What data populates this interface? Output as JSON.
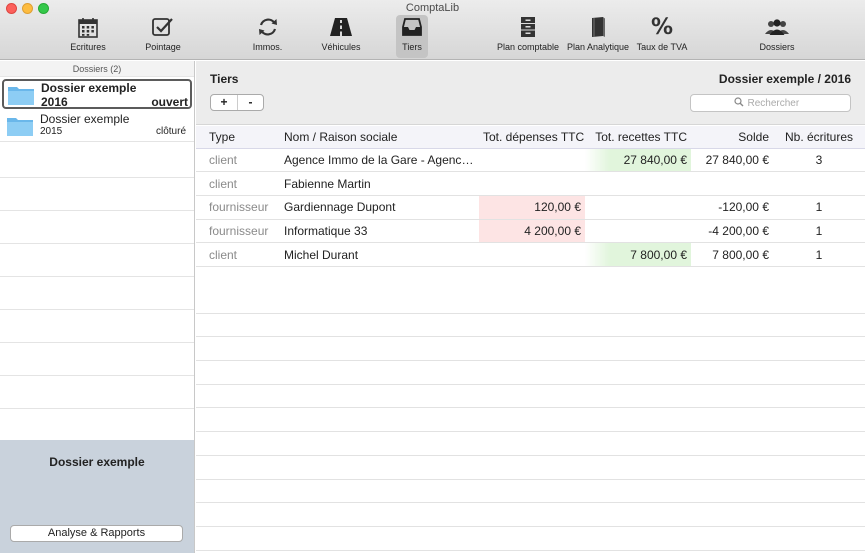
{
  "window": {
    "title": "ComptaLib"
  },
  "toolbar": {
    "items": [
      {
        "label": "Ecritures",
        "icon": "calendar-icon"
      },
      {
        "label": "Pointage",
        "icon": "checkbox-icon"
      },
      {
        "label": "Immos.",
        "icon": "refresh-icon"
      },
      {
        "label": "Véhicules",
        "icon": "road-icon"
      },
      {
        "label": "Tiers",
        "icon": "inbox-icon",
        "active": true
      },
      {
        "label": "Plan comptable",
        "icon": "cabinet-icon"
      },
      {
        "label": "Plan Analytique",
        "icon": "book-icon"
      },
      {
        "label": "Taux de TVA",
        "icon": "percent-icon",
        "symbol": "%"
      },
      {
        "label": "Dossiers",
        "icon": "people-icon"
      }
    ]
  },
  "sidebar": {
    "header": "Dossiers (2)",
    "folders": [
      {
        "name": "Dossier exemple",
        "year": "2016",
        "status": "ouvert",
        "selected": true
      },
      {
        "name": "Dossier exemple",
        "year": "2015",
        "status": "clôturé",
        "selected": false
      }
    ],
    "bottom_title": "Dossier exemple",
    "rapports_button": "Analyse & Rapports"
  },
  "main": {
    "title": "Tiers",
    "dossier_title": "Dossier exemple / 2016",
    "add_label": "+",
    "remove_label": "-",
    "search_placeholder": "Rechercher",
    "columns": [
      "Type",
      "Nom / Raison sociale",
      "Tot. dépenses TTC",
      "Tot. recettes TTC",
      "Solde",
      "Nb. écritures"
    ],
    "rows": [
      {
        "type": "client",
        "name": "Agence Immo de la Gare - Agence Im...",
        "depenses": "",
        "recettes": "27 840,00 €",
        "solde": "27 840,00 €",
        "nb": "3"
      },
      {
        "type": "client",
        "name": "Fabienne Martin",
        "depenses": "",
        "recettes": "",
        "solde": "",
        "nb": ""
      },
      {
        "type": "fournisseur",
        "name": "Gardiennage Dupont",
        "depenses": "120,00 €",
        "recettes": "",
        "solde": "-120,00 €",
        "nb": "1"
      },
      {
        "type": "fournisseur",
        "name": "Informatique 33",
        "depenses": "4 200,00 €",
        "recettes": "",
        "solde": "-4 200,00 €",
        "nb": "1"
      },
      {
        "type": "client",
        "name": "Michel Durant",
        "depenses": "",
        "recettes": "7 800,00 €",
        "solde": "7 800,00 €",
        "nb": "1"
      }
    ]
  },
  "colors": {
    "depense_bg": "#fde4e4",
    "recette_bg": "#e1f5dc",
    "sidebar_bottom_bg": "#c9d2dc",
    "active_tool_bg": "#c4c4c4"
  }
}
